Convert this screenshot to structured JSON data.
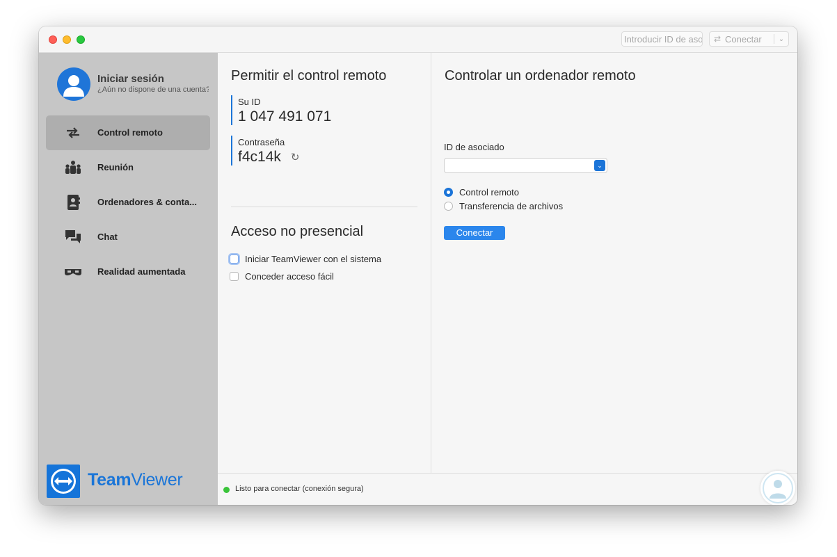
{
  "titlebar": {
    "partner_placeholder": "Introducir ID de asociado",
    "connect_label": "Conectar"
  },
  "sidebar": {
    "login_title": "Iniciar sesión",
    "login_subtitle": "¿Aún no dispone de una cuenta?",
    "items": [
      {
        "label": "Control remoto",
        "icon": "arrows-icon",
        "active": true
      },
      {
        "label": "Reunión",
        "icon": "meeting-icon",
        "active": false
      },
      {
        "label": "Ordenadores & conta...",
        "icon": "contacts-book-icon",
        "active": false
      },
      {
        "label": "Chat",
        "icon": "chat-icon",
        "active": false
      },
      {
        "label": "Realidad aumentada",
        "icon": "ar-glasses-icon",
        "active": false
      }
    ],
    "logo_team": "Team",
    "logo_viewer": "Viewer"
  },
  "allow": {
    "title": "Permitir el control remoto",
    "id_label": "Su ID",
    "id_value": "1 047 491 071",
    "password_label": "Contraseña",
    "password_value": "f4c14k"
  },
  "unattended": {
    "title": "Acceso no presencial",
    "options": [
      {
        "label": "Iniciar TeamViewer con el sistema",
        "checked": false
      },
      {
        "label": "Conceder acceso fácil",
        "checked": false
      }
    ]
  },
  "control": {
    "title": "Controlar un ordenador remoto",
    "partner_id_label": "ID de asociado",
    "partner_id_value": "",
    "modes": [
      {
        "label": "Control remoto",
        "selected": true
      },
      {
        "label": "Transferencia de archivos",
        "selected": false
      }
    ],
    "connect_button": "Conectar"
  },
  "status": {
    "text": "Listo para conectar (conexión segura)",
    "color": "#3ac43a"
  },
  "colors": {
    "accent": "#1b74d8",
    "sidebar_bg": "#c6c6c6",
    "button": "#2b86ec"
  }
}
